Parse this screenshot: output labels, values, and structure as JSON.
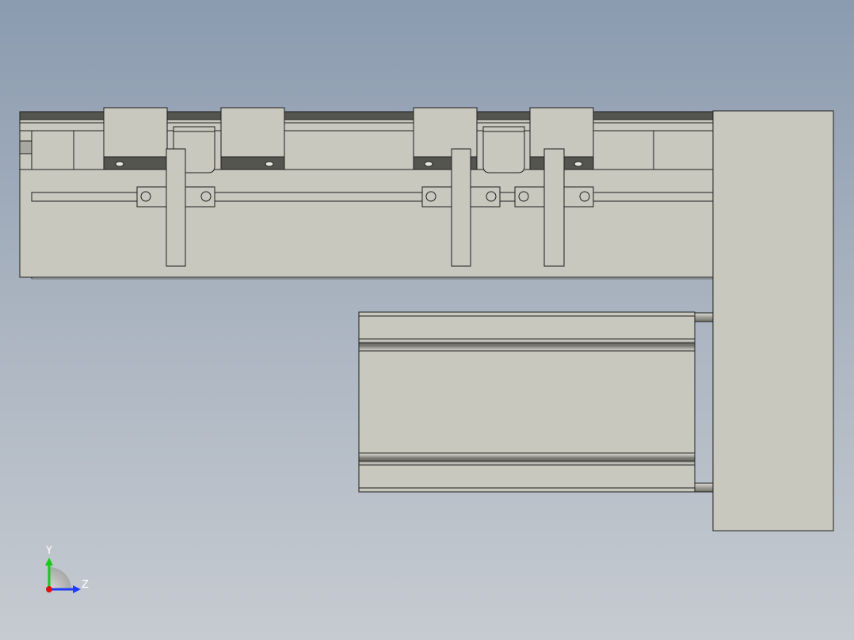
{
  "view": {
    "background_top": "#8b9bb0",
    "background_bottom": "#c6cbd1",
    "part_fill": "#c8c8be",
    "part_stroke": "#1e1e1e",
    "rail_dark": "#55554f"
  },
  "model": {
    "parts": [
      "linear-module-body",
      "top-rail",
      "carriage-left-a",
      "carriage-left-b",
      "carriage-right-a",
      "carriage-right-b",
      "end-cap-left",
      "end-cap-right",
      "mounting-plate",
      "motor-housing",
      "bracket-1",
      "bracket-2",
      "bracket-3",
      "sensor-rail"
    ]
  },
  "triad": {
    "y_label": "Y",
    "z_label": "Z",
    "y_color": "#19c819",
    "z_color": "#1e3cff",
    "x_color": "#e01010"
  }
}
